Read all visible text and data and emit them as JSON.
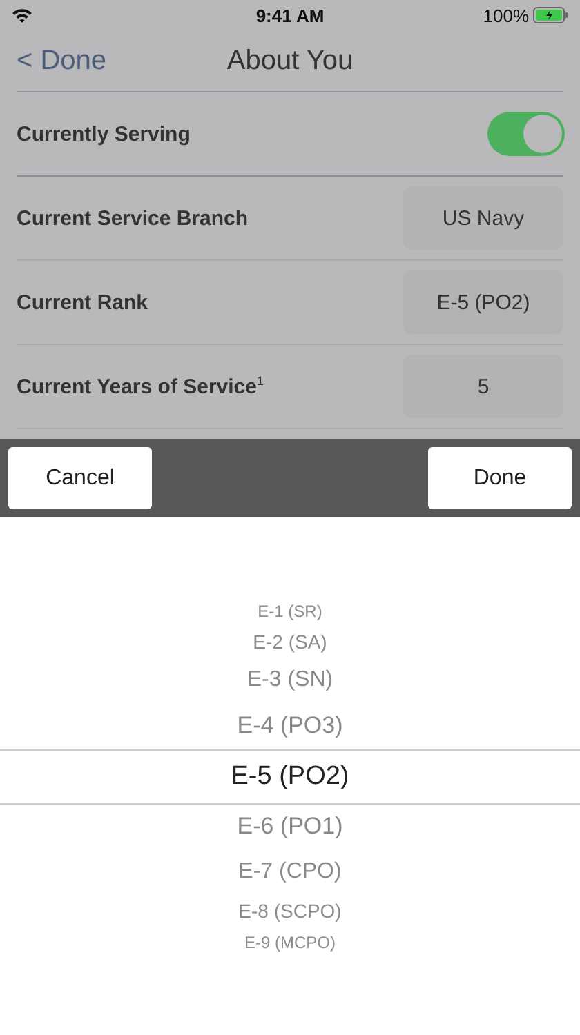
{
  "status_bar": {
    "time": "9:41 AM",
    "battery": "100%"
  },
  "nav": {
    "back": "< Done",
    "title": "About You"
  },
  "rows": [
    {
      "kind": "toggle",
      "label": "Currently Serving",
      "on": true
    },
    {
      "kind": "value",
      "label": "Current Service Branch",
      "value": "US Navy"
    },
    {
      "kind": "value",
      "label": "Current Rank",
      "value": "E-5 (PO2)"
    },
    {
      "kind": "value",
      "label": "Current Years of Service$^{1}$",
      "value": "5"
    }
  ],
  "toolbar": {
    "cancel": "Cancel",
    "done": "Done"
  },
  "picker": [
    {
      "label": "E-1 (SR)",
      "selected": false
    },
    {
      "label": "E-2 (SA)",
      "selected": false
    },
    {
      "label": "E-3 (SN)",
      "selected": false
    },
    {
      "label": "E-4 (PO3)",
      "selected": false
    },
    {
      "label": "E-5 (PO2)",
      "selected": true
    },
    {
      "label": "E-6 (PO1)",
      "selected": false
    },
    {
      "label": "E-7 (CPO)",
      "selected": false
    },
    {
      "label": "E-8 (SCPO)",
      "selected": false
    },
    {
      "label": "E-9 (MCPO)",
      "selected": false
    }
  ]
}
